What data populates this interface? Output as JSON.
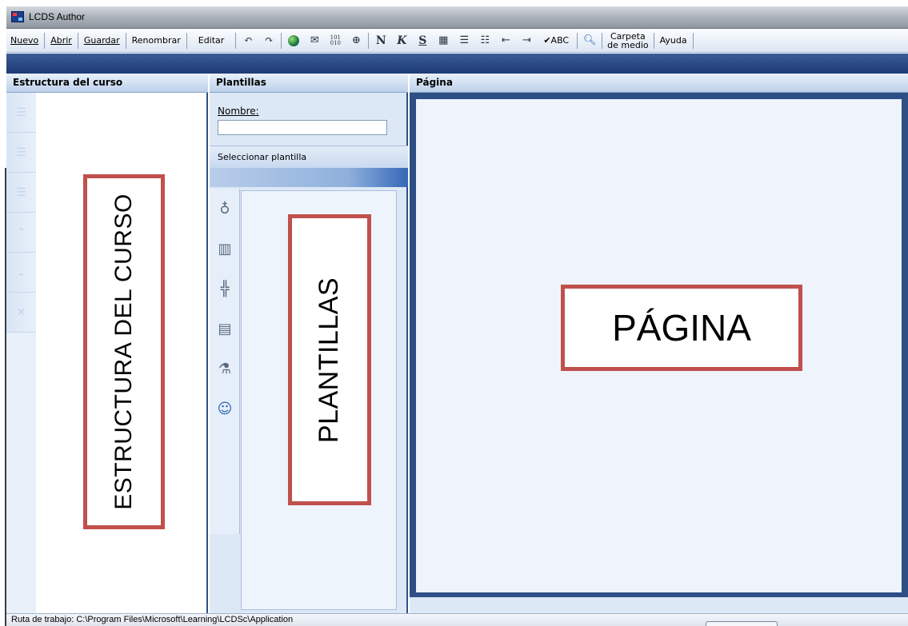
{
  "window": {
    "title": "LCDS Author"
  },
  "toolbar": {
    "nuevo": "Nuevo",
    "abrir": "Abrir",
    "guardar": "Guardar",
    "renombrar": "Renombrar",
    "editar": "Editar",
    "carpeta_line1": "Carpeta",
    "carpeta_line2": "de medio",
    "ayuda": "Ayuda",
    "bold_glyph": "N",
    "italic_glyph": "K",
    "underline_glyph": "S",
    "spell_label": "✔ABC",
    "binary_glyph_line1": "101",
    "binary_glyph_line2": "010"
  },
  "panels": {
    "structure_title": "Estructura del curso",
    "templates_title": "Plantillas",
    "page_title": "Página"
  },
  "templates": {
    "name_label": "Nombre:",
    "name_value": "",
    "select_label": "Seleccionar plantilla"
  },
  "annotations": {
    "structure": "ESTRUCTURA DEL CURSO",
    "templates": "PLANTILLAS",
    "page": "PÁGINA"
  },
  "statusbar": {
    "text": "Ruta de trabajo: C:\\Program Files\\Microsoft\\Learning\\LCDSc\\Application"
  },
  "colors": {
    "annotation_border": "#c0504d",
    "panel_border": "#2d4f86",
    "accent_band": "#2a4a85"
  },
  "icons": {
    "toolbar": [
      "undo-icon",
      "redo-icon",
      "web-link-icon",
      "attach-icon",
      "binary-icon",
      "anchor-icon",
      "bold-icon",
      "italic-icon",
      "underline-icon",
      "table-icon",
      "bullet-list-icon",
      "numbered-list-icon",
      "outdent-icon",
      "indent-icon",
      "spellcheck-icon",
      "preview-icon"
    ],
    "structure": [
      "add-page-icon",
      "add-section-icon",
      "add-topic-icon",
      "move-up-icon",
      "move-down-icon",
      "delete-icon"
    ],
    "templates": [
      "interaction-mouse-icon",
      "media-film-icon",
      "simulation-icon",
      "content-page-icon",
      "lab-icon",
      "assessment-people-icon"
    ]
  }
}
